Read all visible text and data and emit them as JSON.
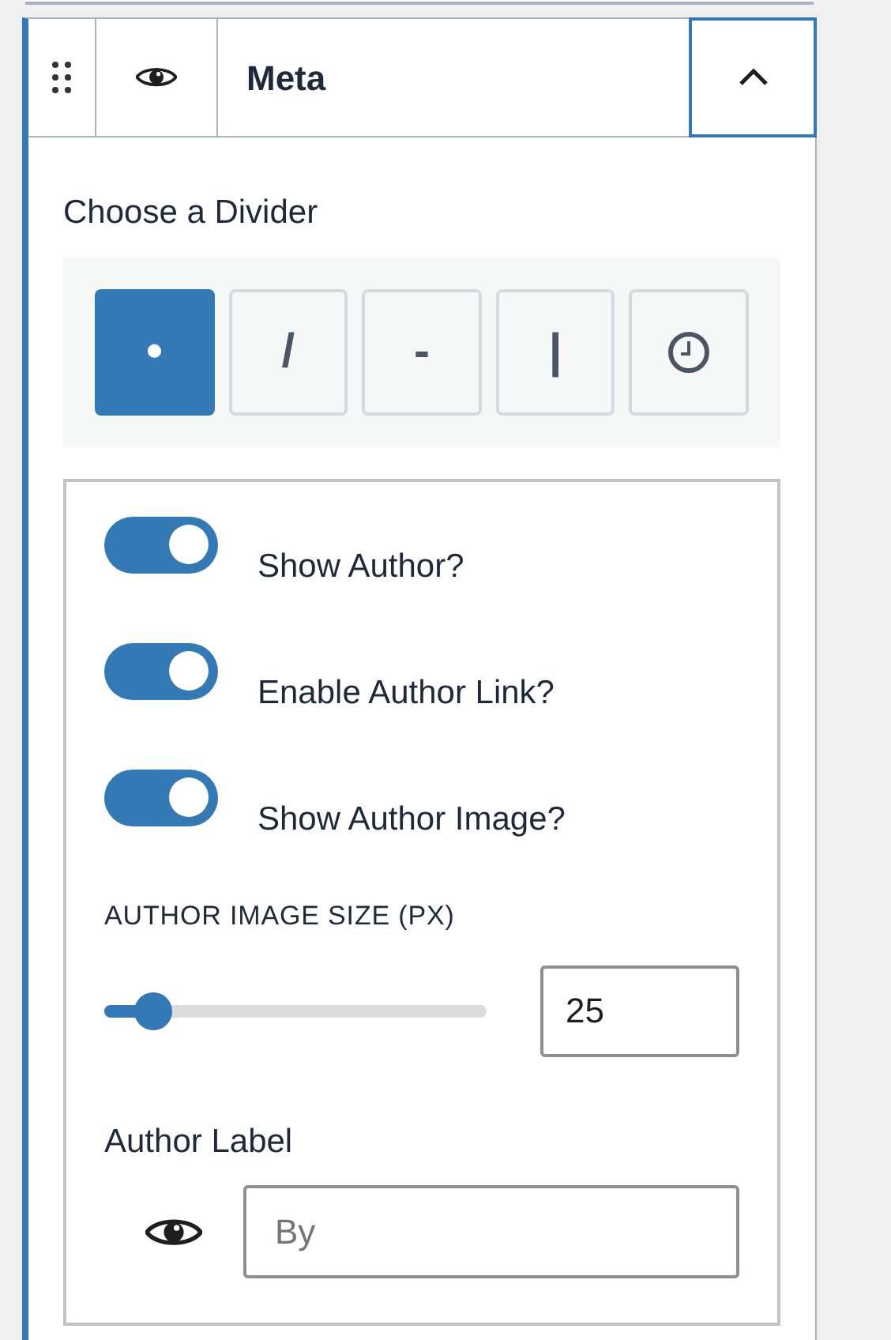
{
  "panel": {
    "title": "Meta",
    "expanded": true
  },
  "divider": {
    "label": "Choose a Divider",
    "options": [
      {
        "kind": "text",
        "symbol": "•",
        "selected": true
      },
      {
        "kind": "text",
        "symbol": "/",
        "selected": false
      },
      {
        "kind": "text",
        "symbol": "-",
        "selected": false
      },
      {
        "kind": "text",
        "symbol": "|",
        "selected": false
      },
      {
        "kind": "icon",
        "selected": false
      }
    ]
  },
  "toggles": [
    {
      "label": "Show Author?",
      "on": true
    },
    {
      "label": "Enable Author Link?",
      "on": true
    },
    {
      "label": "Show Author Image?",
      "on": true
    }
  ],
  "image_size": {
    "label": "AUTHOR IMAGE SIZE (PX)",
    "level": 0.13,
    "value": "25"
  },
  "author_label": {
    "label": "Author Label",
    "placeholder": "By"
  }
}
